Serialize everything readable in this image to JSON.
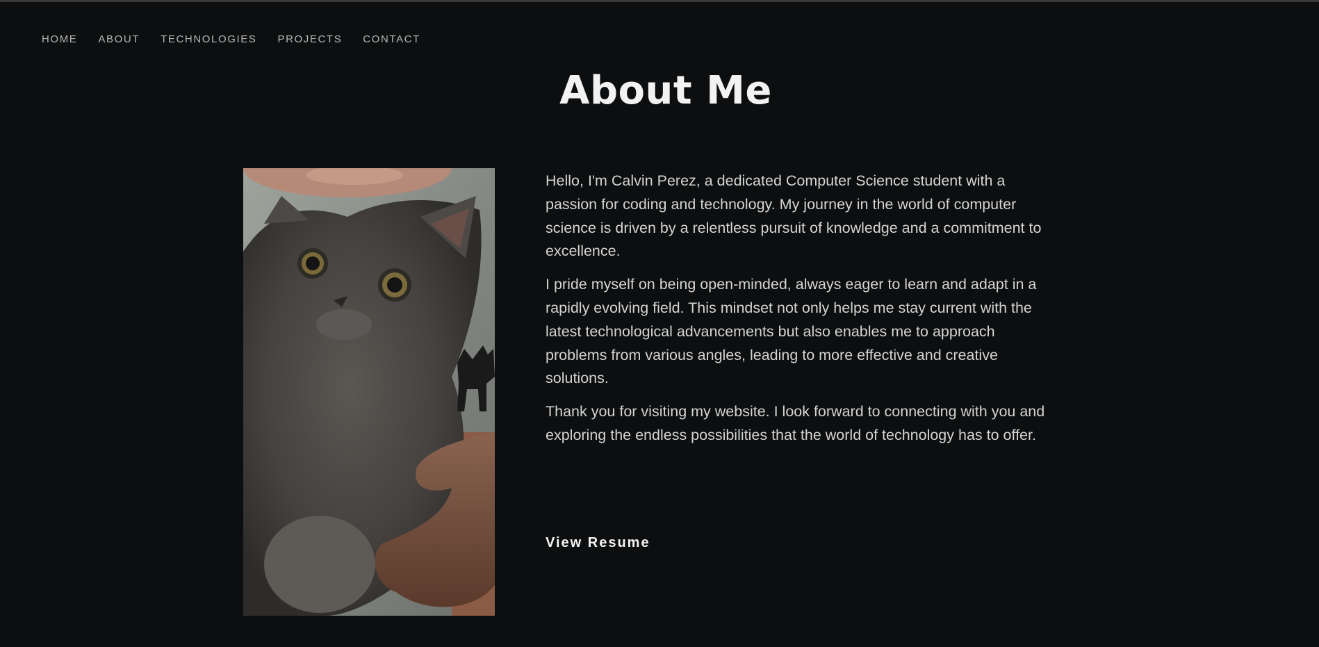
{
  "nav": {
    "items": [
      {
        "label": "HOME"
      },
      {
        "label": "ABOUT"
      },
      {
        "label": "TECHNOLOGIES"
      },
      {
        "label": "PROJECTS"
      },
      {
        "label": "CONTACT"
      }
    ]
  },
  "about": {
    "title": "About Me",
    "photo_icon": "cat-photo",
    "paragraphs": [
      "Hello, I'm Calvin Perez, a dedicated Computer Science student with a passion for coding and technology. My journey in the world of computer science is driven by a relentless pursuit of knowledge and a commitment to excellence.",
      "I pride myself on being open-minded, always eager to learn and adapt in a rapidly evolving field. This mindset not only helps me stay current with the latest technological advancements but also enables me to approach problems from various angles, leading to more effective and creative solutions.",
      "Thank you for visiting my website. I look forward to connecting with you and exploring the endless possibilities that the world of technology has to offer."
    ],
    "resume_label": "View Resume"
  },
  "colors": {
    "background": "#0c0e0f",
    "text": "#d4d4d4",
    "title": "#f2f2f2",
    "nav": "#b9b9b9"
  }
}
